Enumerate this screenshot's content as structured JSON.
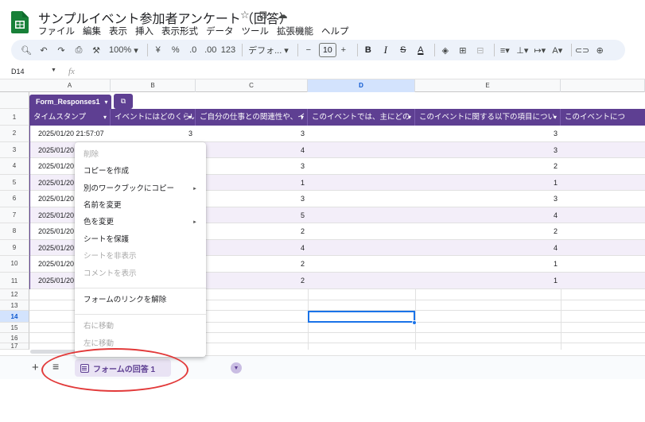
{
  "app": {
    "title": "サンプルイベント参加者アンケート（回答）",
    "title_icons": [
      "star-icon",
      "folder-move-icon",
      "cloud-status-icon"
    ],
    "brand_color": "#188038"
  },
  "menu": [
    "ファイル",
    "編集",
    "表示",
    "挿入",
    "表示形式",
    "データ",
    "ツール",
    "拡張機能",
    "ヘルプ"
  ],
  "toolbar": {
    "zoom": "100%",
    "currency": "¥",
    "percent": "%",
    "decimal_decrease": ".0",
    "decimal_increase": ".00",
    "number_format": "123",
    "font": "デフォ...",
    "font_size": "10",
    "bold": "B",
    "italic": "I",
    "strike": "S",
    "text_color": "A"
  },
  "formula_bar": {
    "name_box": "D14",
    "fx": "fx"
  },
  "columns": [
    "A",
    "B",
    "C",
    "D",
    "E"
  ],
  "selected_column": "D",
  "table": {
    "name": "Form_Responses1",
    "header_color": "#5e3f92",
    "headers": [
      "タイムスタンプ",
      "イベントにはどのくらい",
      "ご自分の仕事との関連性や、イ",
      "このイベントでは、主にどの",
      "このイベントに関する以下の項目につい",
      "このイベントにつ"
    ],
    "rows": [
      {
        "ts": "2025/01/20 21:57:07",
        "b": "3",
        "c": "3",
        "e": "3"
      },
      {
        "ts": "2025/01/20",
        "b": "",
        "c": "4",
        "e": "3"
      },
      {
        "ts": "2025/01/20",
        "b": "",
        "c": "3",
        "e": "2"
      },
      {
        "ts": "2025/01/20",
        "b": "",
        "c": "1",
        "e": "1"
      },
      {
        "ts": "2025/01/20",
        "b": "",
        "c": "3",
        "e": "3"
      },
      {
        "ts": "2025/01/20",
        "b": "",
        "c": "5",
        "e": "4"
      },
      {
        "ts": "2025/01/20",
        "b": "",
        "c": "2",
        "e": "2"
      },
      {
        "ts": "2025/01/20",
        "b": "",
        "c": "4",
        "e": "4"
      },
      {
        "ts": "2025/01/20",
        "b": "",
        "c": "2",
        "e": "1"
      },
      {
        "ts": "2025/01/20",
        "b": "",
        "c": "2",
        "e": "1"
      }
    ]
  },
  "row_numbers": [
    "1",
    "2",
    "3",
    "4",
    "5",
    "6",
    "7",
    "8",
    "9",
    "10",
    "11",
    "12",
    "13",
    "14",
    "15",
    "16",
    "17"
  ],
  "selected_row": "14",
  "context_menu": {
    "items": [
      {
        "label": "削除",
        "disabled": true,
        "submenu": false
      },
      {
        "label": "コピーを作成",
        "disabled": false,
        "submenu": false
      },
      {
        "label": "別のワークブックにコピー",
        "disabled": false,
        "submenu": true
      },
      {
        "label": "名前を変更",
        "disabled": false,
        "submenu": false
      },
      {
        "label": "色を変更",
        "disabled": false,
        "submenu": true
      },
      {
        "label": "シートを保護",
        "disabled": false,
        "submenu": false
      },
      {
        "label": "シートを非表示",
        "disabled": true,
        "submenu": false
      },
      {
        "label": "コメントを表示",
        "disabled": true,
        "submenu": false
      },
      {
        "label": "フォームのリンクを解除",
        "disabled": false,
        "submenu": false
      },
      {
        "label": "右に移動",
        "disabled": true,
        "submenu": false
      },
      {
        "label": "左に移動",
        "disabled": true,
        "submenu": false
      }
    ]
  },
  "sheet_bar": {
    "add": "+",
    "all_sheets": "≡",
    "active_tab": "フォームの回答 1"
  },
  "annotation_color": "#e23a3a"
}
